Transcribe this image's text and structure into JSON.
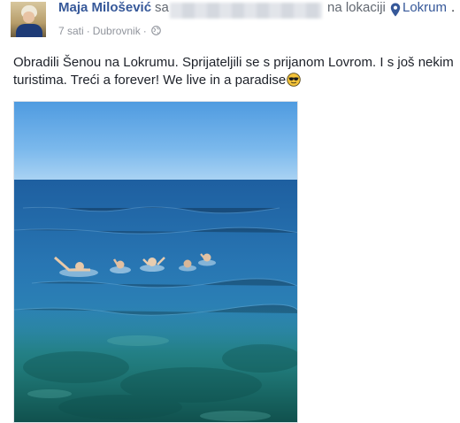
{
  "post": {
    "author": "Maja Milošević",
    "with_prefix": "sa",
    "at_label": "na lokaciji",
    "location": "Lokrum",
    "trailing_period": ".",
    "time": "7 sati",
    "meta_separator": "·",
    "place": "Dubrovnik",
    "privacy_icon": "globe-icon",
    "location_icon": "map-pin-icon",
    "text_line_1": "Obradili Šenou na Lokrumu. Sprijateljili se s prijanom Lovrom. I s još nekim",
    "text_line_2": "turistima. Treći a forever! We live in a paradise",
    "emoji": "sunglasses-emoji",
    "link_color": "#365899"
  }
}
